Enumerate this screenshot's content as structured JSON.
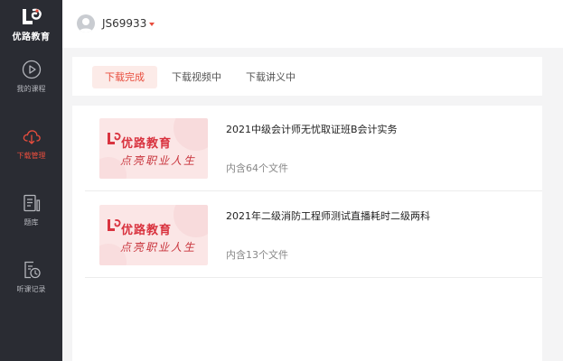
{
  "brand": {
    "name": "优路教育",
    "color": "#e84d3d"
  },
  "sidebar": {
    "items": [
      {
        "label": "我的课程",
        "icon": "play-circle-icon"
      },
      {
        "label": "下载管理",
        "icon": "cloud-download-icon",
        "active": true
      },
      {
        "label": "题库",
        "icon": "question-bank-icon"
      },
      {
        "label": "听课记录",
        "icon": "history-icon"
      }
    ]
  },
  "header": {
    "username": "JS69933"
  },
  "tabs": [
    {
      "label": "下载完成",
      "active": true
    },
    {
      "label": "下载视频中"
    },
    {
      "label": "下载讲义中"
    }
  ],
  "thumbnail": {
    "brand": "优路教育",
    "slogan": "点亮职业人生"
  },
  "courses": [
    {
      "title": "2021中级会计师无忧取证班B会计实务",
      "file_count": "内含64个文件"
    },
    {
      "title": "2021年二级消防工程师测试直播耗时二级两科",
      "file_count": "内含13个文件"
    }
  ]
}
